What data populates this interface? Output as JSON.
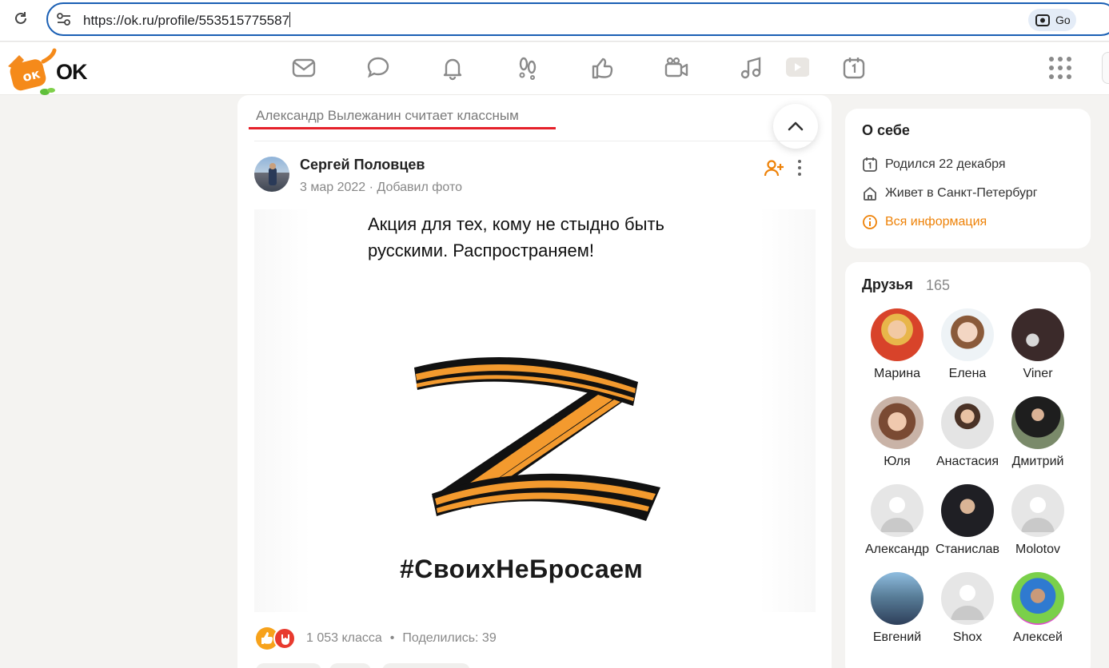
{
  "browser": {
    "url": "https://ok.ru/profile/553515775587",
    "lens_label": "Go"
  },
  "okbar": {
    "logo_text": "OK",
    "icons": [
      "messages-icon",
      "discussions-icon",
      "notifications-icon",
      "guests-icon",
      "events-icon",
      "video-call-icon",
      "music-icon",
      "video-icon",
      "calendar-icon"
    ]
  },
  "feed": {
    "header_text": "Александр Вылежанин считает классным",
    "post": {
      "author": "Сергей Половцев",
      "date": "3 мар 2022",
      "separator": "·",
      "action": "Добавил фото",
      "photo_caption": "Акция для тех, кому не стыдно быть русскими. Распространяем!",
      "photo_hashtag": "#СвоихНеБросаем",
      "likes": "1 053 класса",
      "stats_dot": "•",
      "shares": "Поделились: 39"
    }
  },
  "about": {
    "title": "О себе",
    "birthday": "Родился 22 декабря",
    "city": "Живет в Санкт-Петербург",
    "all_info": "Вся информация"
  },
  "friends": {
    "title": "Друзья",
    "count": "165",
    "items": [
      {
        "name": "Марина"
      },
      {
        "name": "Елена"
      },
      {
        "name": "Viner"
      },
      {
        "name": "Юля"
      },
      {
        "name": "Анастасия"
      },
      {
        "name": "Дмитрий"
      },
      {
        "name": "Александр"
      },
      {
        "name": "Станислав"
      },
      {
        "name": "Molotov"
      },
      {
        "name": "Евгений"
      },
      {
        "name": "Shox"
      },
      {
        "name": "Алексей"
      }
    ]
  },
  "colors": {
    "accent_orange": "#ee8208",
    "url_border": "#1a5fb4",
    "underline_red": "#e5202a"
  }
}
